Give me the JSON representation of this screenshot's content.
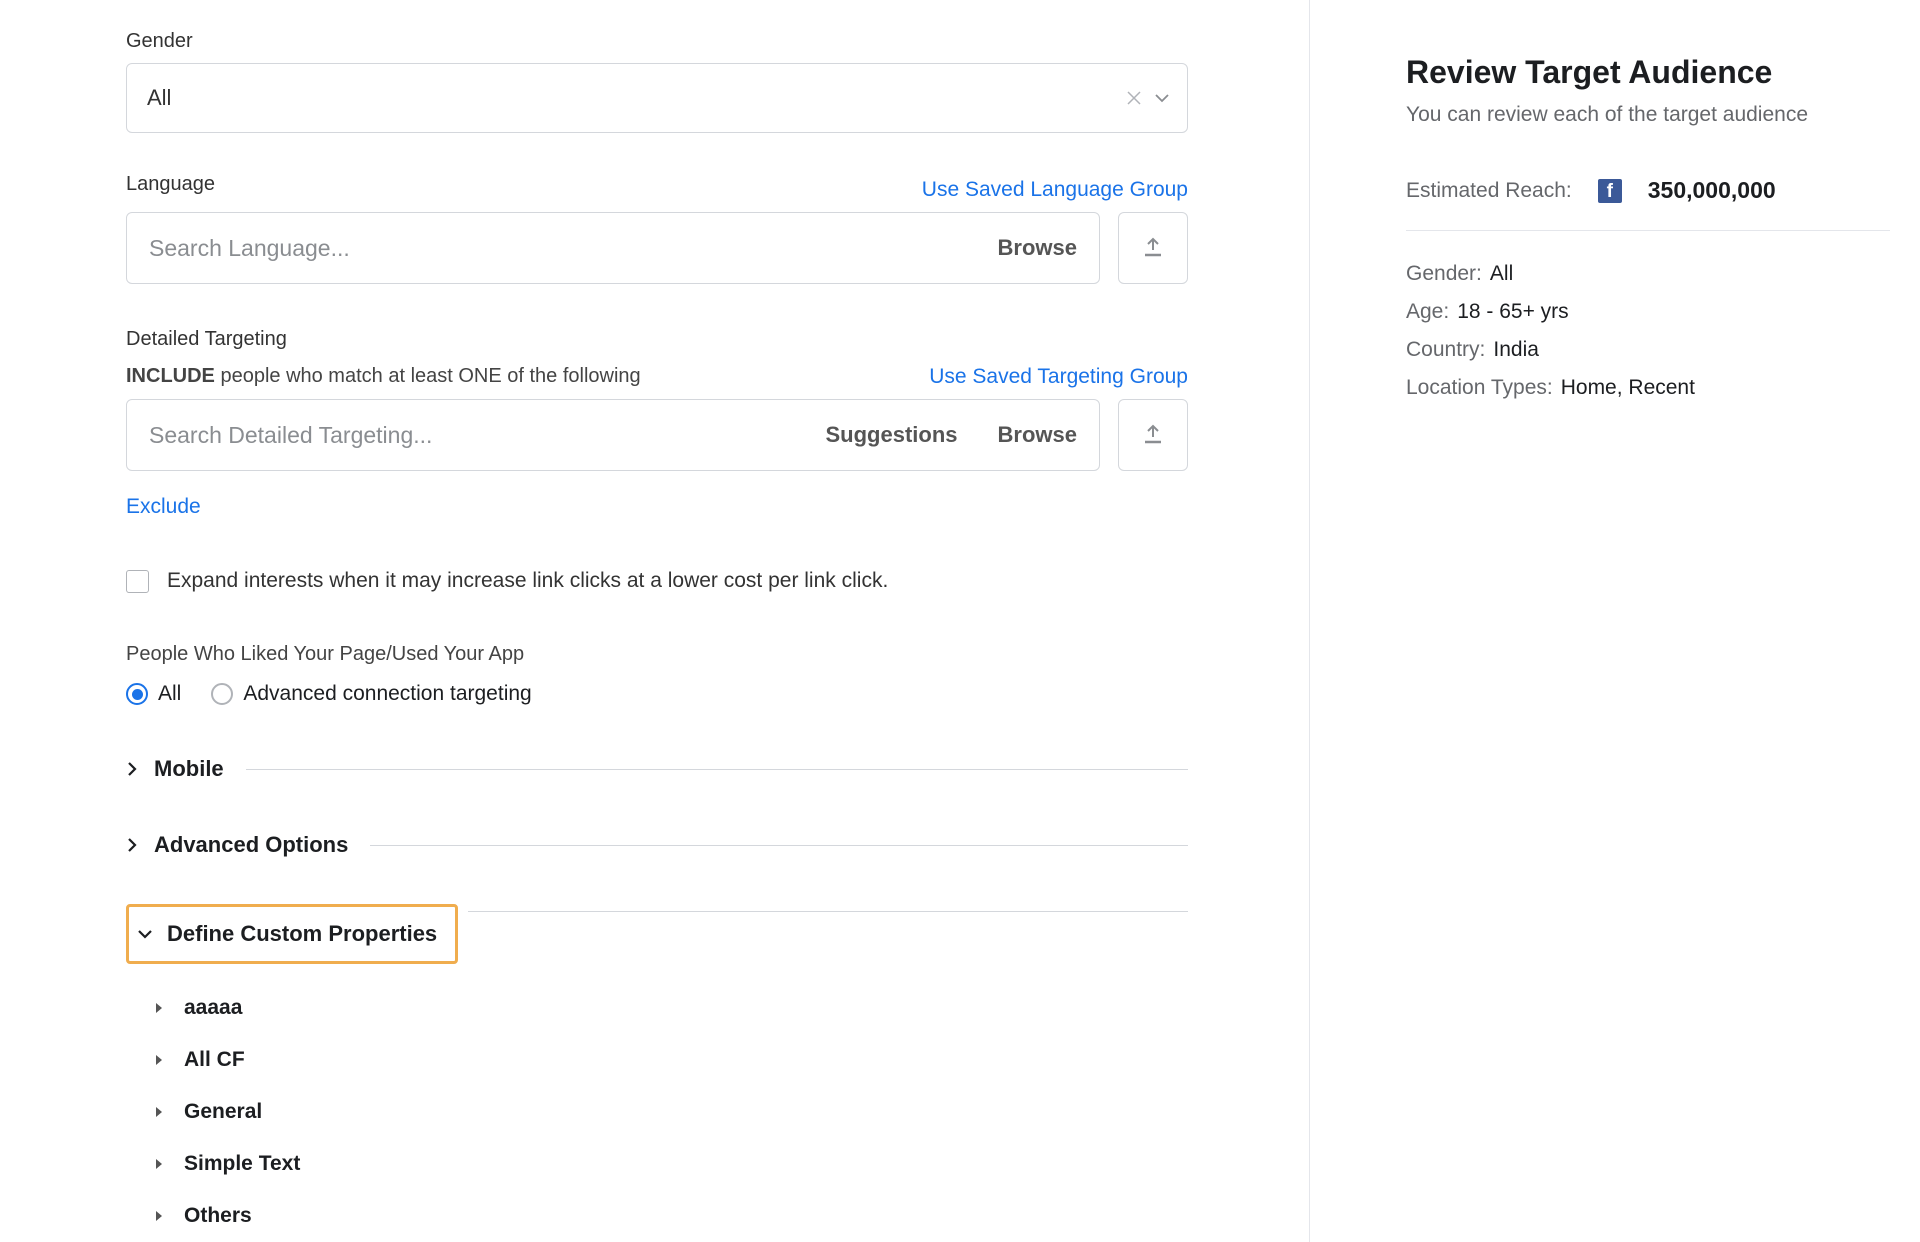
{
  "main": {
    "gender": {
      "label": "Gender",
      "value": "All"
    },
    "language": {
      "label": "Language",
      "use_saved_link": "Use Saved Language Group",
      "placeholder": "Search Language...",
      "browse": "Browse"
    },
    "targeting": {
      "heading": "Detailed Targeting",
      "include_bold": "INCLUDE",
      "include_rest": " people who match at least ONE of the following",
      "use_saved_link": "Use Saved Targeting Group",
      "placeholder": "Search Detailed Targeting...",
      "suggestions": "Suggestions",
      "browse": "Browse",
      "exclude": "Exclude"
    },
    "expand_checkbox": "Expand interests when it may increase link clicks at a lower cost per link click.",
    "connection": {
      "label": "People Who Liked Your Page/Used Your App",
      "opt_all": "All",
      "opt_adv": "Advanced connection targeting"
    },
    "sections": {
      "mobile": "Mobile",
      "advanced": "Advanced Options",
      "custom": "Define Custom Properties"
    },
    "custom_items": [
      "aaaaa",
      "All CF",
      "General",
      "Simple Text",
      "Others"
    ]
  },
  "side": {
    "title": "Review Target Audience",
    "subtitle": "You can review each of the target audience",
    "reach_label": "Estimated Reach:",
    "reach_value": "350,000,000",
    "rows": {
      "gender_lbl": "Gender:",
      "gender_val": "All",
      "age_lbl": "Age:",
      "age_val": "18 - 65+ yrs",
      "country_lbl": "Country:",
      "country_val": "India",
      "loc_lbl": "Location Types:",
      "loc_val": "Home, Recent"
    }
  }
}
